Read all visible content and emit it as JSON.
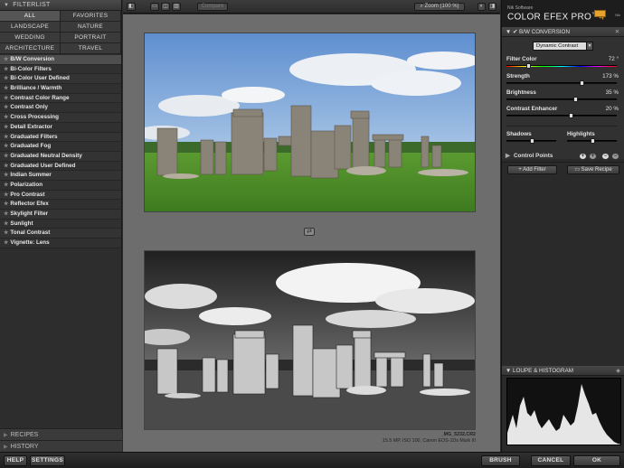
{
  "left_panel": {
    "header": "FILTERLIST",
    "categories": [
      "ALL",
      "FAVORITES",
      "LANDSCAPE",
      "NATURE",
      "WEDDING",
      "PORTRAIT",
      "ARCHITECTURE",
      "TRAVEL"
    ],
    "filters": [
      "B/W Conversion",
      "Bi-Color Filters",
      "Bi-Color User Defined",
      "Brilliance / Warmth",
      "Contrast Color Range",
      "Contrast Only",
      "Cross Processing",
      "Detail Extractor",
      "Graduated Filters",
      "Graduated Fog",
      "Graduated Neutral Density",
      "Graduated User Defined",
      "Indian Summer",
      "Polarization",
      "Pro Contrast",
      "Reflector Efex",
      "Skylight Filter",
      "Sunlight",
      "Tonal Contrast",
      "Vignette: Lens"
    ],
    "recipes_label": "RECIPES",
    "history_label": "HISTORY"
  },
  "toolbar": {
    "compare_label": "Compare",
    "zoom_label": "Zoom (100 %)"
  },
  "center": {
    "caption_file": "_MG_5232.CR2",
    "caption_info": "15.5 MP, ISO 100, Canon EOS-1Ds Mark III"
  },
  "right_panel": {
    "brand_small": "Nik Software",
    "brand_name": "COLOR EFEX PRO",
    "brand_tm": "™",
    "brand_version": "4",
    "logo_text": "Nik",
    "section_title": "B/W CONVERSION",
    "preset": "Dynamic Contrast",
    "sliders": [
      {
        "label": "Filter Color",
        "value": "72",
        "unit": "°",
        "fraction": 0.2
      },
      {
        "label": "Strength",
        "value": "173",
        "unit": "%",
        "fraction": 0.68
      },
      {
        "label": "Brightness",
        "value": "35",
        "unit": "%",
        "fraction": 0.62
      },
      {
        "label": "Contrast Enhancer",
        "value": "20",
        "unit": "%",
        "fraction": 0.58
      }
    ],
    "shadows_label": "Shadows",
    "highlights_label": "Highlights",
    "control_points_label": "Control Points",
    "add_filter_label": "+ Add Filter",
    "save_recipe_label": "Save Recipe",
    "loupe_label": "LOUPE & HISTOGRAM"
  },
  "bottom_bar": {
    "help": "HELP",
    "settings": "SETTINGS",
    "brush": "BRUSH",
    "cancel": "CANCEL",
    "ok": "OK"
  },
  "colors": {
    "accent": "#e5a32b",
    "grass": "#4f8a2a",
    "sky": "#7fa8d8"
  }
}
